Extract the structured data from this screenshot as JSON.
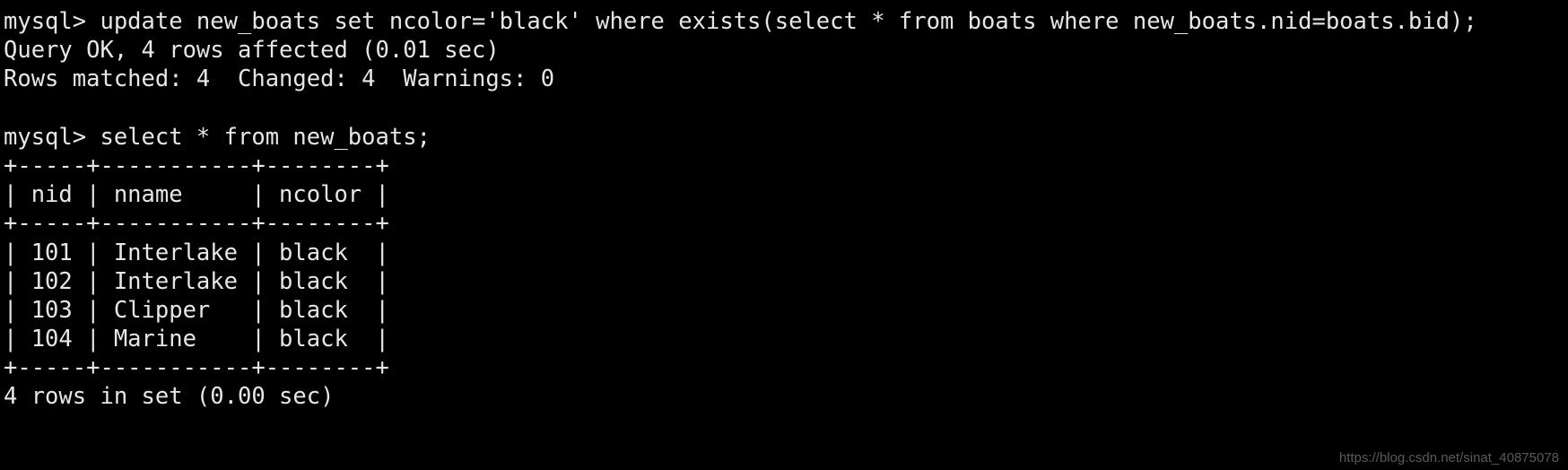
{
  "terminal": {
    "prompt": "mysql>",
    "lines": [
      "mysql> update new_boats set ncolor='black' where exists(select * from boats where new_boats.nid=boats.bid);",
      "Query OK, 4 rows affected (0.01 sec)",
      "Rows matched: 4  Changed: 4  Warnings: 0",
      "",
      "mysql> select * from new_boats;",
      "+-----+-----------+--------+",
      "| nid | nname     | ncolor |",
      "+-----+-----------+--------+",
      "| 101 | Interlake | black  |",
      "| 102 | Interlake | black  |",
      "| 103 | Clipper   | black  |",
      "| 104 | Marine    | black  |",
      "+-----+-----------+--------+",
      "4 rows in set (0.00 sec)"
    ],
    "commands": [
      "update new_boats set ncolor='black' where exists(select * from boats where new_boats.nid=boats.bid);",
      "select * from new_boats;"
    ],
    "status_messages": [
      "Query OK, 4 rows affected (0.01 sec)",
      "Rows matched: 4  Changed: 4  Warnings: 0",
      "4 rows in set (0.00 sec)"
    ],
    "result_table": {
      "columns": [
        "nid",
        "nname",
        "ncolor"
      ],
      "rows": [
        [
          "101",
          "Interlake",
          "black"
        ],
        [
          "102",
          "Interlake",
          "black"
        ],
        [
          "103",
          "Clipper",
          "black"
        ],
        [
          "104",
          "Marine",
          "black"
        ]
      ],
      "row_count": 4,
      "elapsed": "0.00 sec"
    },
    "colors": {
      "background": "#000000",
      "foreground": "#e6e6e6",
      "watermark": "#5a5a5a"
    }
  },
  "watermark": {
    "text": "https://blog.csdn.net/sinat_40875078"
  }
}
